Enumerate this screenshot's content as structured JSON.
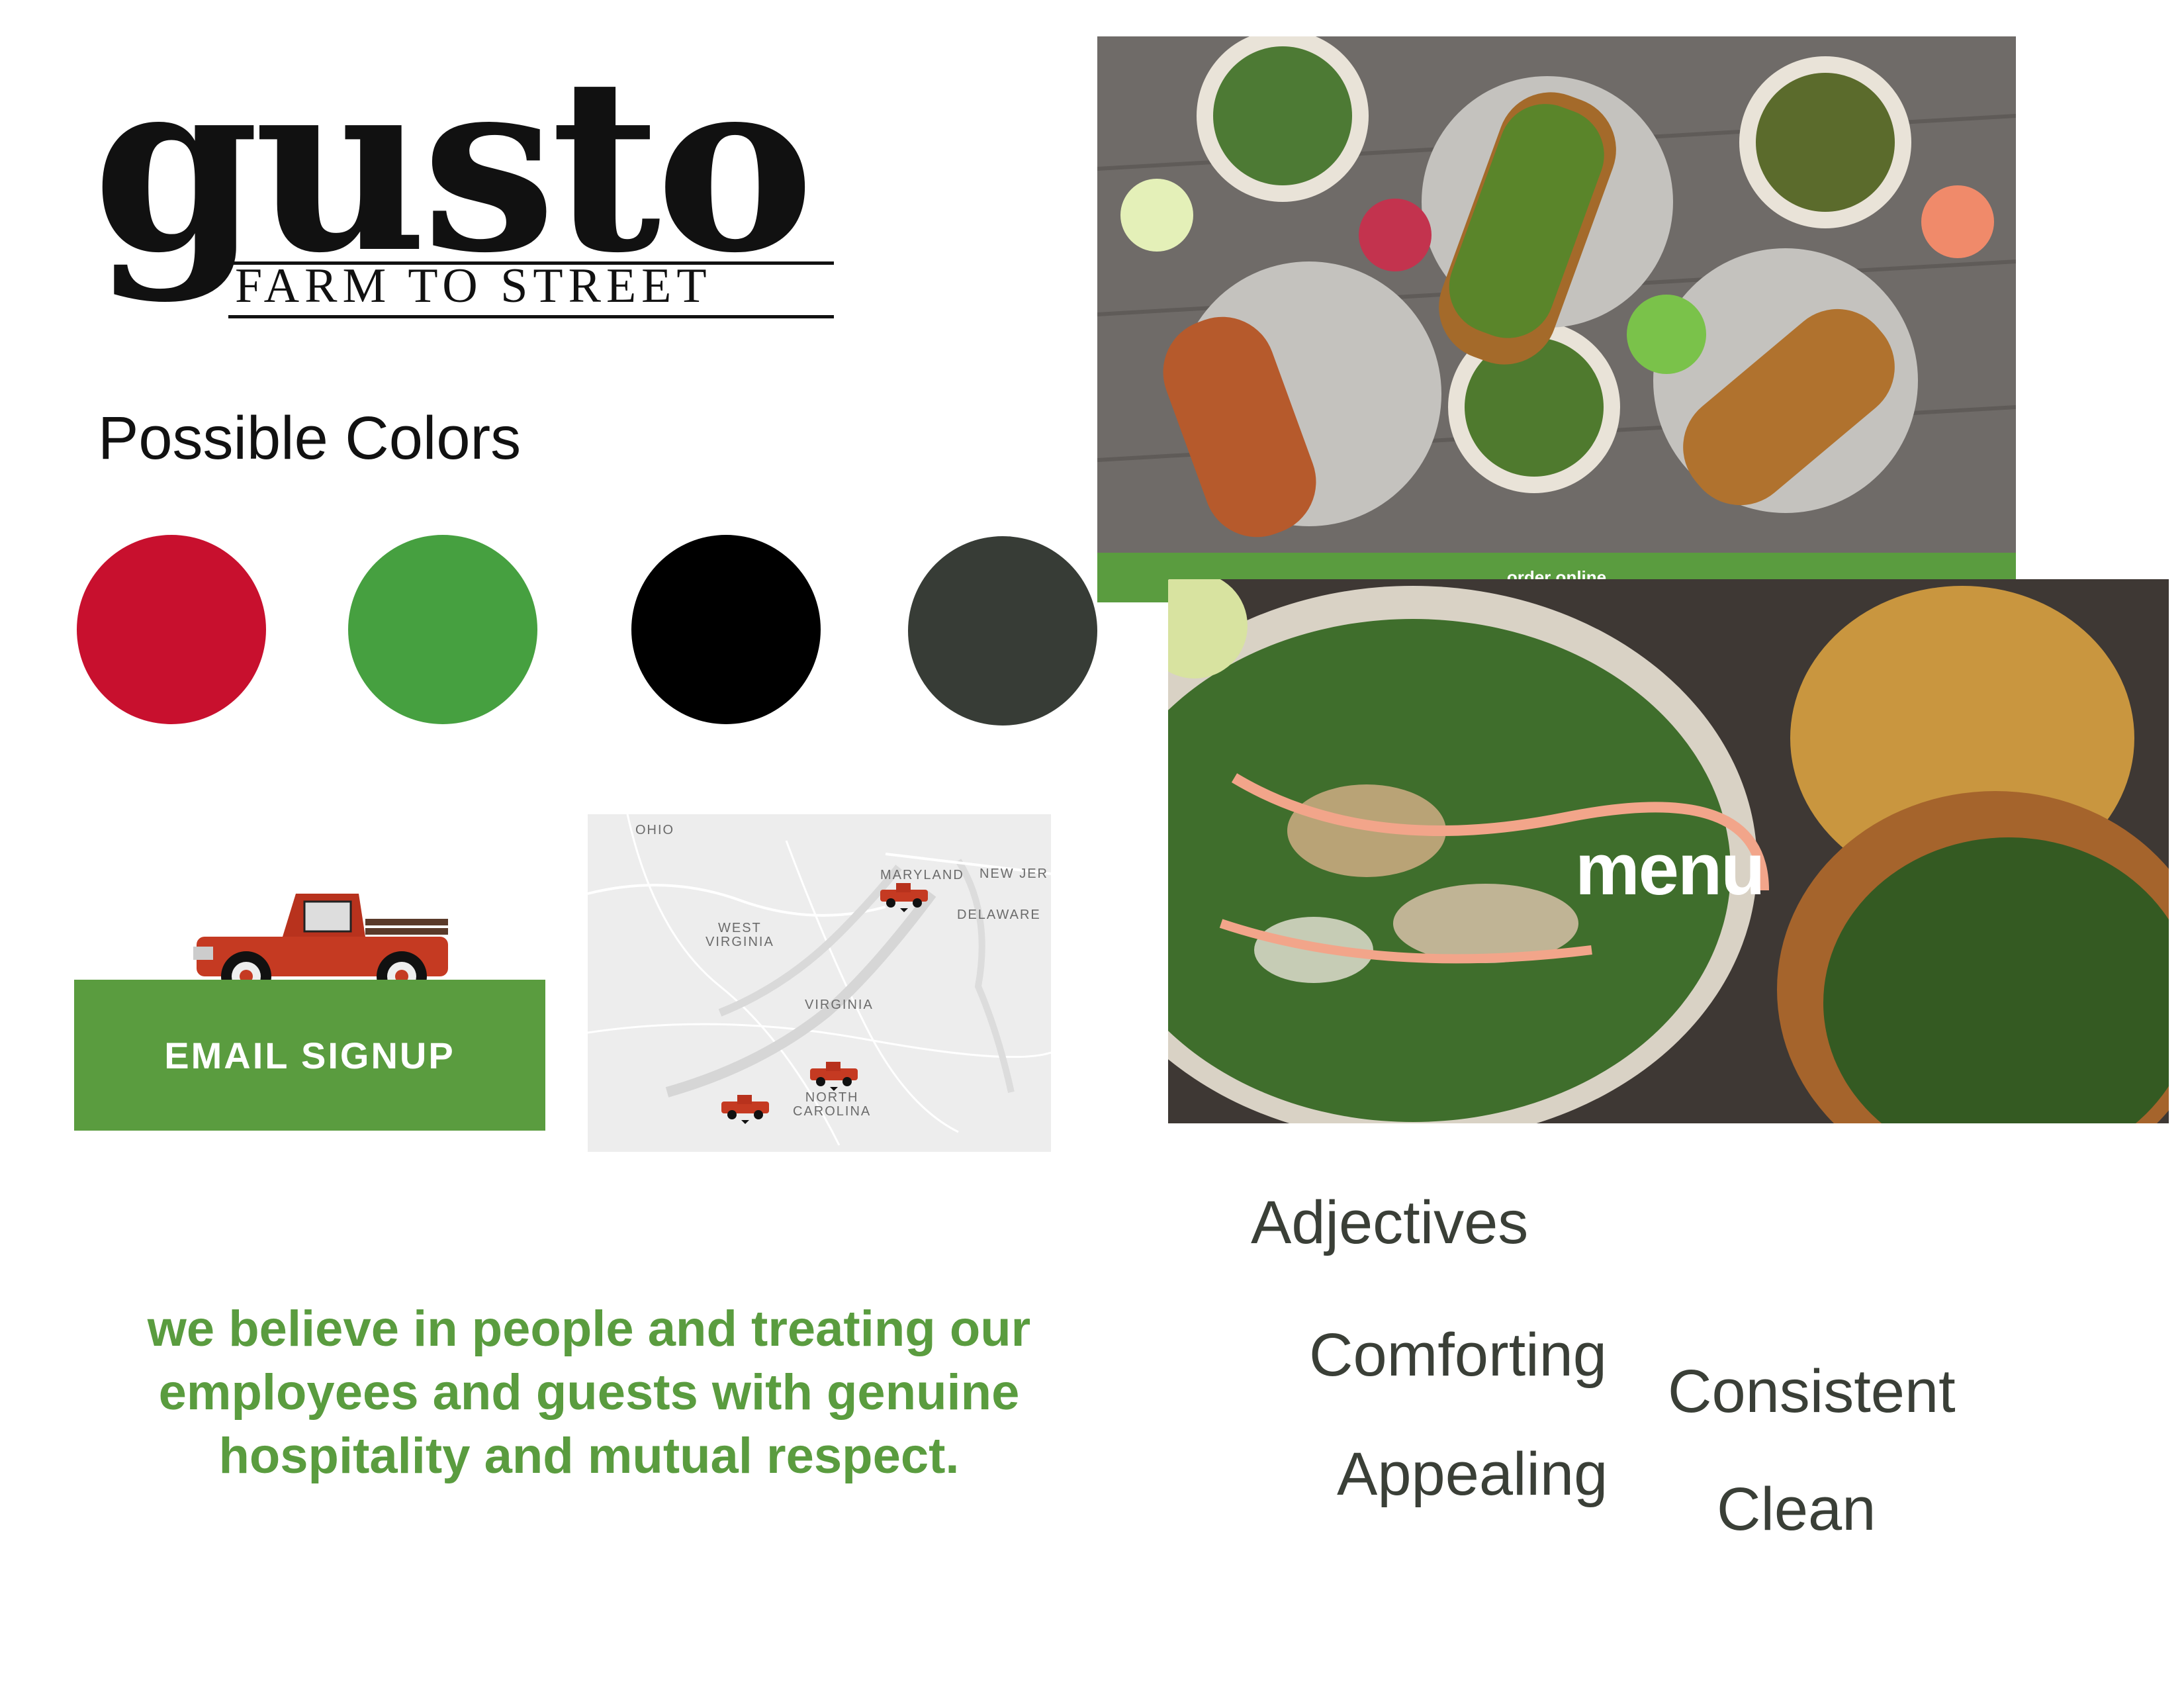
{
  "logo": {
    "word": "gusto",
    "tagline": "FARM TO STREET"
  },
  "palette": {
    "title": "Possible Colors",
    "colors": [
      "#c8102e",
      "#46a040",
      "#000000",
      "#373c36"
    ]
  },
  "email_signup": {
    "label": "EMAIL SIGNUP"
  },
  "map": {
    "labels": {
      "ohio": "OHIO",
      "maryland": "MARYLAND",
      "new_jersey": "NEW JER",
      "delaware": "DELAWARE",
      "west_virginia_1": "WEST",
      "west_virginia_2": "VIRGINIA",
      "virginia": "VIRGINIA",
      "north_carolina_1": "NORTH",
      "north_carolina_2": "CAROLINA"
    }
  },
  "photo1": {
    "order_label": "order online"
  },
  "photo2": {
    "menu_label": "menu"
  },
  "adjectives": {
    "title": "Adjectives",
    "items": [
      "Comforting",
      "Consistent",
      "Appealing",
      "Clean"
    ]
  },
  "values_text": "we believe in people and treating our employees and guests with genuine hospitality and mutual respect."
}
